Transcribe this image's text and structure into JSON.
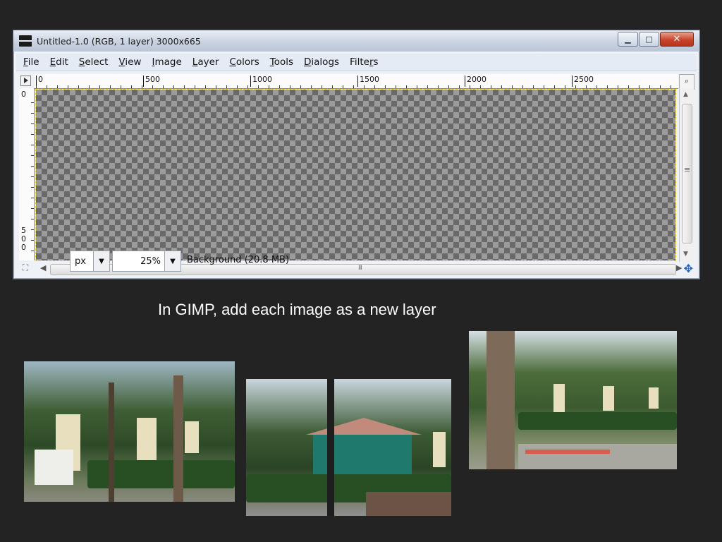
{
  "window": {
    "title": "Untitled-1.0 (RGB, 1 layer) 3000x665",
    "controls": {
      "minimize": "▁",
      "maximize": "□",
      "close": "✕"
    }
  },
  "menu": [
    {
      "label": "File",
      "u": "F"
    },
    {
      "label": "Edit",
      "u": "E"
    },
    {
      "label": "Select",
      "u": "S"
    },
    {
      "label": "View",
      "u": "V"
    },
    {
      "label": "Image",
      "u": "I"
    },
    {
      "label": "Layer",
      "u": "L"
    },
    {
      "label": "Colors",
      "u": "C"
    },
    {
      "label": "Tools",
      "u": "T"
    },
    {
      "label": "Dialogs",
      "u": "D"
    },
    {
      "label": "Filters",
      "u": "r"
    }
  ],
  "ruler": {
    "horizontal": [
      "0",
      "500",
      "1000",
      "1500",
      "2000",
      "2500"
    ],
    "vertical_top": "0",
    "vertical_mid": "500"
  },
  "status": {
    "unit": "px",
    "zoom": "25%",
    "layer_info": "Background (20.8 MB)"
  },
  "caption": "In GIMP, add each image as a new layer",
  "colors": {
    "background": "#232323",
    "selection_outline": "#f2d72b",
    "close_button": "#c8452c"
  }
}
